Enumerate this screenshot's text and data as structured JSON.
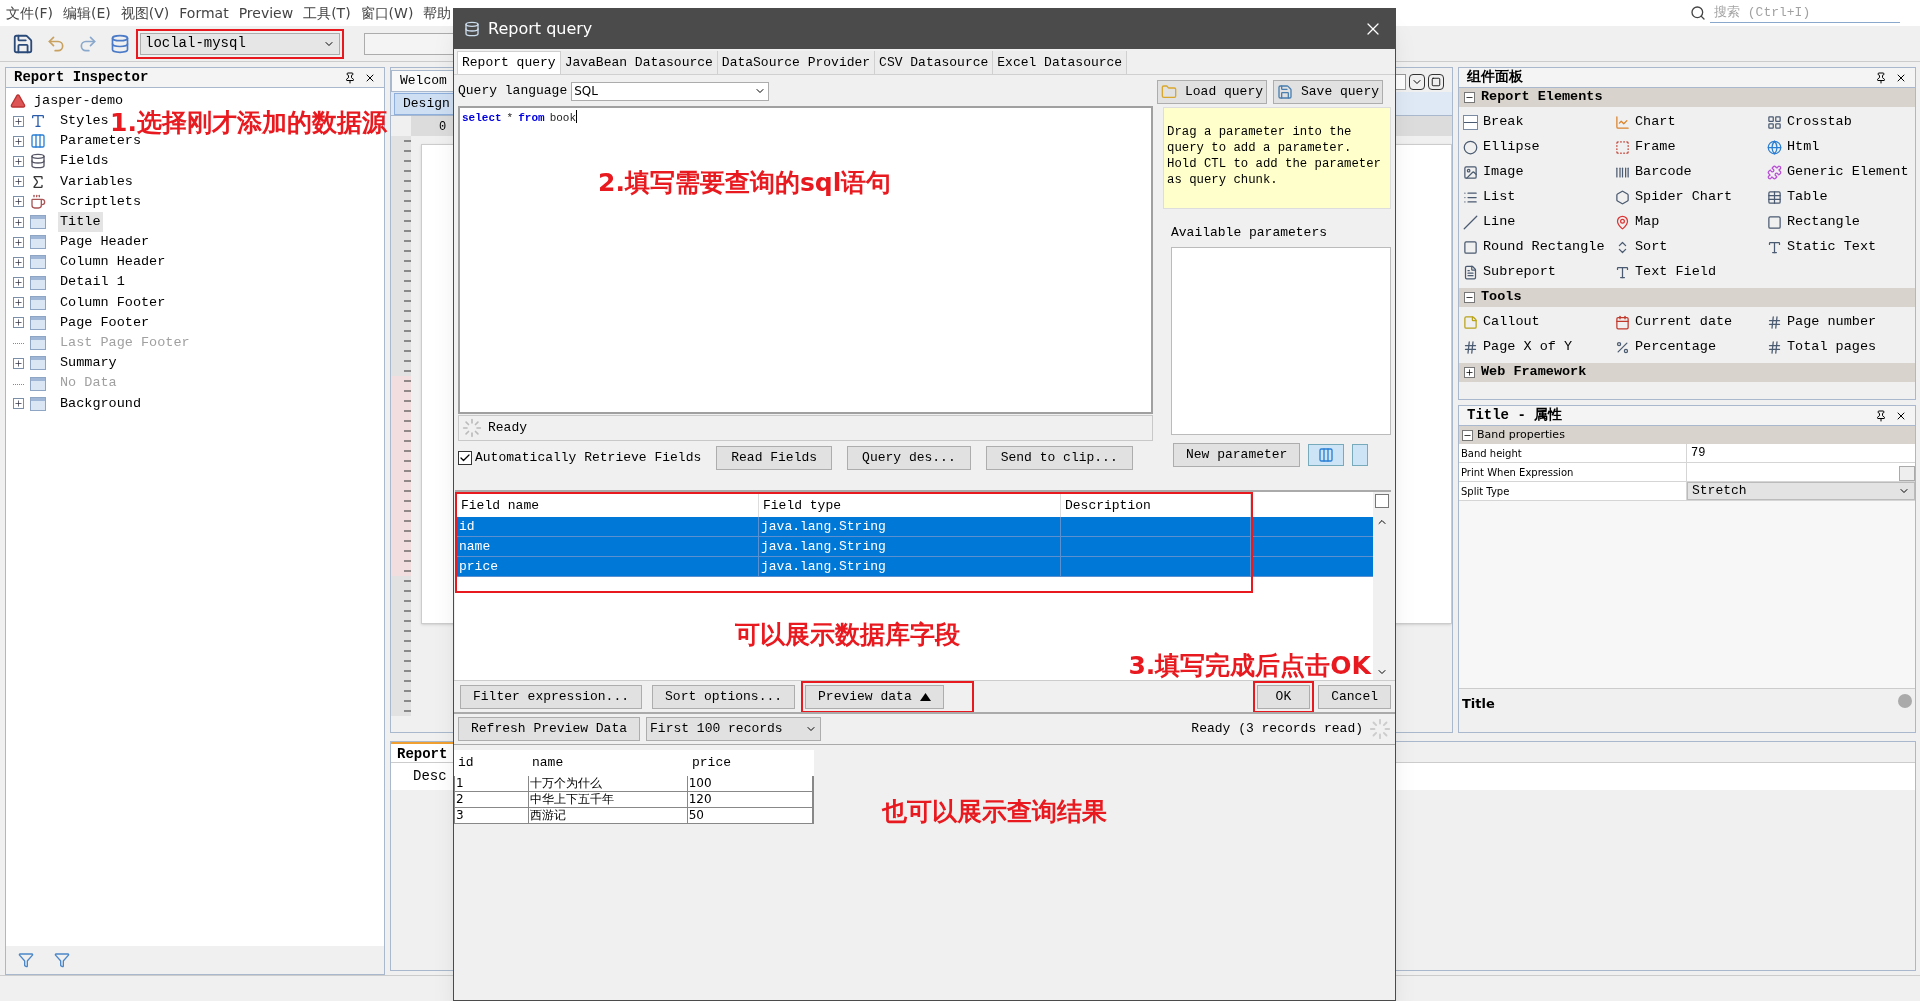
{
  "menu_bar": [
    "文件(F)",
    "编辑(E)",
    "视图(V)",
    "Format",
    "Preview",
    "工具(T)",
    "窗口(W)",
    "帮助"
  ],
  "toolbar": {
    "datasource": {
      "value": "loclal-mysql",
      "annotated": true
    },
    "search": {
      "placeholder": "搜索 (Ctrl+I)"
    }
  },
  "inspector": {
    "title": "Report Inspector",
    "annotation": "1.选择刚才添加的数据源",
    "root": {
      "label": "jasper-demo",
      "children": [
        {
          "label": "Styles",
          "kind": "styles",
          "expandable": true,
          "disabled": false,
          "selected": false
        },
        {
          "label": "Parameters",
          "kind": "parameters",
          "expandable": true,
          "disabled": false,
          "selected": false
        },
        {
          "label": "Fields",
          "kind": "fields",
          "expandable": true,
          "disabled": false,
          "selected": false
        },
        {
          "label": "Variables",
          "kind": "variables",
          "expandable": true,
          "disabled": false,
          "selected": false
        },
        {
          "label": "Scriptlets",
          "kind": "scriptlets",
          "expandable": true,
          "disabled": false,
          "selected": false
        },
        {
          "label": "Title",
          "kind": "band",
          "expandable": true,
          "disabled": false,
          "selected": true
        },
        {
          "label": "Page Header",
          "kind": "band",
          "expandable": true,
          "disabled": false,
          "selected": false
        },
        {
          "label": "Column Header",
          "kind": "band",
          "expandable": true,
          "disabled": false,
          "selected": false
        },
        {
          "label": "Detail 1",
          "kind": "band",
          "expandable": true,
          "disabled": false,
          "selected": false
        },
        {
          "label": "Column Footer",
          "kind": "band",
          "expandable": true,
          "disabled": false,
          "selected": false
        },
        {
          "label": "Page Footer",
          "kind": "band",
          "expandable": true,
          "disabled": false,
          "selected": false
        },
        {
          "label": "Last Page Footer",
          "kind": "band",
          "expandable": false,
          "disabled": true,
          "selected": false
        },
        {
          "label": "Summary",
          "kind": "band",
          "expandable": true,
          "disabled": false,
          "selected": false
        },
        {
          "label": "No Data",
          "kind": "band",
          "expandable": false,
          "disabled": true,
          "selected": false
        },
        {
          "label": "Background",
          "kind": "band",
          "expandable": true,
          "disabled": false,
          "selected": false
        }
      ]
    }
  },
  "designer": {
    "tabs": [
      {
        "label": "Welcom",
        "selected": false
      }
    ],
    "view_tabs": [
      {
        "label": "Design",
        "selected": true
      }
    ],
    "ruler_label": "0",
    "report_panel": {
      "title": "Report",
      "column": "Desc"
    }
  },
  "dialog": {
    "title": "Report query",
    "tabs": [
      {
        "label": "Report query",
        "selected": true
      },
      {
        "label": "JavaBean Datasource",
        "selected": false
      },
      {
        "label": "DataSource Provider",
        "selected": false
      },
      {
        "label": "CSV Datasource",
        "selected": false
      },
      {
        "label": "Excel Datasource",
        "selected": false
      }
    ],
    "query_language": {
      "label": "Query language",
      "value": "SQL"
    },
    "query": [
      {
        "text": "select",
        "kind": "keyword"
      },
      {
        "text": "*",
        "kind": "plain"
      },
      {
        "text": "from",
        "kind": "keyword"
      },
      {
        "text": "book",
        "kind": "plain"
      }
    ],
    "query_annotation": "2.填写需要查询的sql语句",
    "load_query": "Load query",
    "save_query": "Save query",
    "hint": "Drag a parameter into the query to add a parameter. Hold CTL to add the parameter as query chunk.",
    "available_parameters": "Available parameters",
    "new_parameter": "New parameter",
    "status": "Ready",
    "auto_retrieve": {
      "label": "Automatically Retrieve Fields",
      "checked": true
    },
    "field_buttons": [
      "Read Fields",
      "Query des...",
      "Send to clip..."
    ],
    "fields_table": {
      "annotated": true,
      "columns": [
        "Field name",
        "Field type",
        "Description"
      ],
      "rows": [
        {
          "cells": [
            "id",
            "java.lang.String",
            ""
          ],
          "selected": true
        },
        {
          "cells": [
            "name",
            "java.lang.String",
            ""
          ],
          "selected": true
        },
        {
          "cells": [
            "price",
            "java.lang.String",
            ""
          ],
          "selected": true
        }
      ]
    },
    "fields_annotation": "可以展示数据库字段",
    "ok_annotation": "3.填写完成后点击OK",
    "buttons": [
      {
        "label": "Filter expression...",
        "kind": "plain",
        "annotated": false
      },
      {
        "label": "Sort options...",
        "kind": "plain",
        "annotated": false
      },
      {
        "label": "Preview data",
        "kind": "toggle",
        "annotated": true
      }
    ],
    "ok": {
      "label": "OK",
      "annotated": true
    },
    "cancel": "Cancel",
    "preview": {
      "refresh": "Refresh Preview Data",
      "records": "First 100 records",
      "status": "Ready (3 records read)",
      "columns": [
        "id",
        "name",
        "price"
      ],
      "rows": [
        [
          "1",
          "十万个为什么",
          "100"
        ],
        [
          "2",
          "中华上下五千年",
          "120"
        ],
        [
          "3",
          "西游记",
          "50"
        ]
      ],
      "annotation": "也可以展示查询结果"
    }
  },
  "palette": {
    "title": "组件面板",
    "sections": [
      {
        "title": "Report Elements",
        "expanded": true,
        "items": [
          {
            "label": "Break",
            "kind": "break"
          },
          {
            "label": "Chart",
            "kind": "chart"
          },
          {
            "label": "Crosstab",
            "kind": "crosstab"
          },
          {
            "label": "Ellipse",
            "kind": "ellipse"
          },
          {
            "label": "Frame",
            "kind": "frame"
          },
          {
            "label": "Html",
            "kind": "html"
          },
          {
            "label": "Image",
            "kind": "image"
          },
          {
            "label": "Barcode",
            "kind": "barcode"
          },
          {
            "label": "Generic Element",
            "kind": "generic"
          },
          {
            "label": "List",
            "kind": "list"
          },
          {
            "label": "Spider Chart",
            "kind": "spider"
          },
          {
            "label": "Table",
            "kind": "table"
          },
          {
            "label": "Line",
            "kind": "line"
          },
          {
            "label": "Map",
            "kind": "map"
          },
          {
            "label": "Rectangle",
            "kind": "rectangle"
          },
          {
            "label": "Round Rectangle",
            "kind": "round_rectangle"
          },
          {
            "label": "Sort",
            "kind": "sort"
          },
          {
            "label": "Static Text",
            "kind": "static_text"
          },
          {
            "label": "Subreport",
            "kind": "subreport"
          },
          {
            "label": "Text Field",
            "kind": "text_field"
          }
        ]
      },
      {
        "title": "Tools",
        "expanded": true,
        "items": [
          {
            "label": "Callout",
            "kind": "callout"
          },
          {
            "label": "Current date",
            "kind": "date"
          },
          {
            "label": "Page number",
            "kind": "hash"
          },
          {
            "label": "Page X of Y",
            "kind": "hash"
          },
          {
            "label": "Percentage",
            "kind": "percent"
          },
          {
            "label": "Total pages",
            "kind": "hash"
          }
        ]
      },
      {
        "title": "Web Framework",
        "expanded": false
      }
    ]
  },
  "properties": {
    "title": "Title - 属性",
    "section": "Band properties",
    "rows": [
      {
        "label": "Band height",
        "value": "79",
        "kind": "text"
      },
      {
        "label": "Print When Expression",
        "kind": "expression"
      },
      {
        "label": "Split Type",
        "value": "Stretch",
        "kind": "select"
      }
    ],
    "footer": "Title"
  }
}
